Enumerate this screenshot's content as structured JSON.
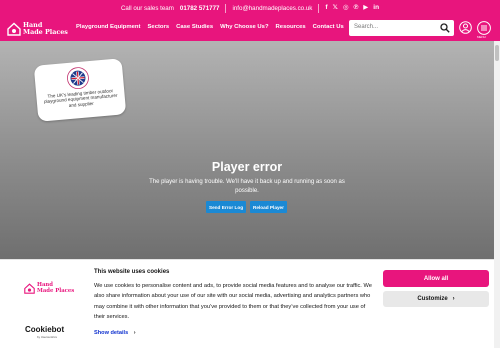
{
  "topbar": {
    "call_text": "Call our sales team",
    "phone": "01782 571777",
    "email": "info@handmadeplaces.co.uk",
    "social": [
      "f",
      "𝕏",
      "◎",
      "℗",
      "▶",
      "in"
    ],
    "social_icons": [
      "facebook-icon",
      "x-icon",
      "instagram-icon",
      "pinterest-icon",
      "youtube-icon",
      "linkedin-icon"
    ]
  },
  "logo": {
    "line1": "Hand",
    "line2": "Made Places"
  },
  "nav": {
    "items": [
      "Playground Equipment",
      "Sectors",
      "Case Studies",
      "Why Choose Us?",
      "Resources",
      "Contact Us"
    ],
    "search_placeholder": "Search...",
    "menu_label": "MENU"
  },
  "badge": {
    "text": "The UK's leading timber outdoor playground equipment manufacturer and supplier"
  },
  "player": {
    "title": "Player error",
    "message": "The player is having trouble. We'll have it back up and running as soon as possible.",
    "send_log": "Send Error Log",
    "reload": "Reload Player"
  },
  "cookie": {
    "title": "This website uses cookies",
    "body": "We use cookies to personalise content and ads, to provide social media features and to analyse our traffic. We also share information about your use of our site with our social media, advertising and analytics partners who may combine it with other information that you’ve provided to them or that they’ve collected from your use of their services.",
    "show_details": "Show details",
    "allow_all": "Allow all",
    "customize": "Customize",
    "brand": "Cookiebot",
    "brand_by": "by Usercentrics"
  },
  "colors": {
    "brand": "#e8157d",
    "player_button": "#1b89d4",
    "link": "#1032cf"
  }
}
